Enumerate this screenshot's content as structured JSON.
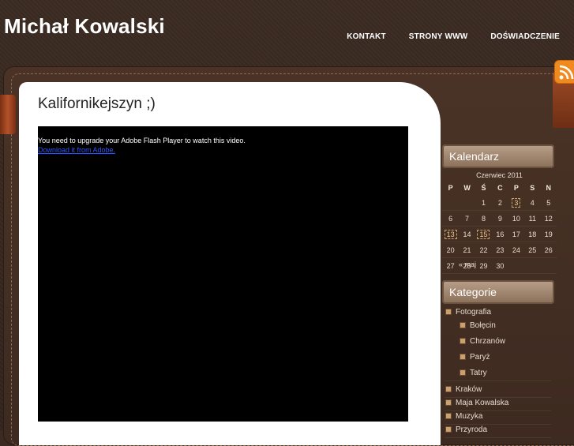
{
  "header": {
    "site_title": "Michał Kowalski",
    "nav": [
      "KONTAKT",
      "STRONY WWW",
      "DOŚWIADCZENIE"
    ]
  },
  "post": {
    "title": "Kalifornikejszyn ;)",
    "flash_message": "You need to upgrade your Adobe Flash Player to watch this video.",
    "flash_link": "Download it from Adobe."
  },
  "sidebar": {
    "calendar": {
      "heading": "Kalendarz",
      "caption": "Czerwiec 2011",
      "days": [
        "P",
        "W",
        "Ś",
        "C",
        "P",
        "S",
        "N"
      ],
      "weeks": [
        [
          "",
          "",
          "1",
          "2",
          "3",
          "4",
          "5"
        ],
        [
          "6",
          "7",
          "8",
          "9",
          "10",
          "11",
          "12"
        ],
        [
          "13",
          "14",
          "15",
          "16",
          "17",
          "18",
          "19"
        ],
        [
          "20",
          "21",
          "22",
          "23",
          "24",
          "25",
          "26"
        ],
        [
          "27",
          "28",
          "29",
          "30",
          "",
          "",
          ""
        ]
      ],
      "marked_days": [
        "3",
        "13",
        "15"
      ],
      "prev_link": "« maj"
    },
    "categories": {
      "heading": "Kategorie",
      "items": [
        {
          "label": "Fotografia",
          "level": 0
        },
        {
          "label": "Bołęcin",
          "level": 1
        },
        {
          "label": "Chrzanów",
          "level": 1
        },
        {
          "label": "Paryż",
          "level": 1
        },
        {
          "label": "Tatry",
          "level": 1
        },
        {
          "label": "Kraków",
          "level": 0
        },
        {
          "label": "Maja Kowalska",
          "level": 0
        },
        {
          "label": "Muzyka",
          "level": 0
        },
        {
          "label": "Przyroda",
          "level": 0
        }
      ]
    }
  },
  "colors": {
    "background": "#3a2a22",
    "content_bg": "#ffffff",
    "widget_head": "#a88e78",
    "rss_orange": "#f18a1e",
    "link_blue": "#2d55ff"
  }
}
